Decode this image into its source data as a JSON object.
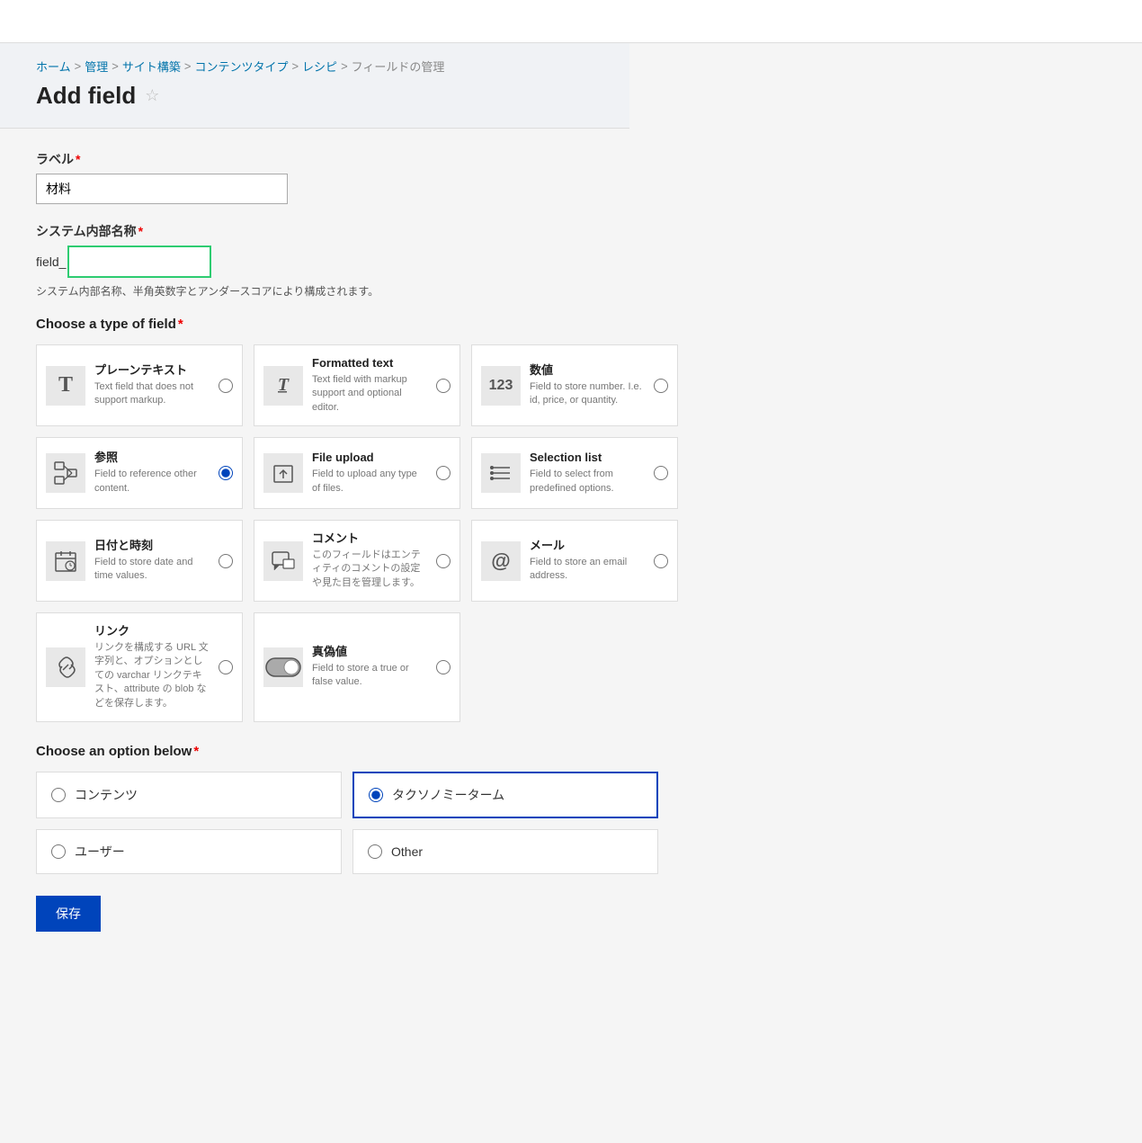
{
  "topBar": {},
  "breadcrumb": {
    "items": [
      "ホーム",
      "管理",
      "サイト構築",
      "コンテンツタイプ",
      "レシピ",
      "フィールドの管理"
    ],
    "separators": [
      ">",
      ">",
      ">",
      ">",
      ">"
    ]
  },
  "pageHeader": {
    "title": "Add field",
    "starLabel": "☆"
  },
  "labelField": {
    "label": "ラベル",
    "required": true,
    "value": "材料",
    "placeholder": ""
  },
  "systemNameField": {
    "label": "システム内部名称",
    "required": true,
    "prefix": "field_",
    "value": "",
    "placeholder": "",
    "helpText": "システム内部名称、半角英数字とアンダースコアにより構成されます。"
  },
  "fieldTypeSection": {
    "title": "Choose a type of field",
    "required": true,
    "types": [
      {
        "id": "plain_text",
        "iconType": "T",
        "name": "プレーンテキスト",
        "desc": "Text field that does not support markup.",
        "selected": false
      },
      {
        "id": "formatted_text",
        "iconType": "formatted",
        "name": "Formatted text",
        "desc": "Text field with markup support and optional editor.",
        "selected": false
      },
      {
        "id": "number",
        "iconType": "123",
        "name": "数値",
        "desc": "Field to store number. I.e. id, price, or quantity.",
        "selected": false
      },
      {
        "id": "reference",
        "iconType": "ref",
        "name": "参照",
        "desc": "Field to reference other content.",
        "selected": true
      },
      {
        "id": "file_upload",
        "iconType": "file",
        "name": "File upload",
        "desc": "Field to upload any type of files.",
        "selected": false
      },
      {
        "id": "selection_list",
        "iconType": "list",
        "name": "Selection list",
        "desc": "Field to select from predefined options.",
        "selected": false
      },
      {
        "id": "date_time",
        "iconType": "date",
        "name": "日付と時刻",
        "desc": "Field to store date and time values.",
        "selected": false
      },
      {
        "id": "comment",
        "iconType": "comment",
        "name": "コメント",
        "desc": "このフィールドはエンティティのコメントの設定や見た目を管理します。",
        "selected": false
      },
      {
        "id": "email",
        "iconType": "email",
        "name": "メール",
        "desc": "Field to store an email address.",
        "selected": false
      },
      {
        "id": "link",
        "iconType": "link",
        "name": "リンク",
        "desc": "リンクを構成する URL 文字列と、オプションとしての varchar リンクテキスト、attribute の blob などを保存します。",
        "selected": false
      },
      {
        "id": "boolean",
        "iconType": "bool",
        "name": "真偽値",
        "desc": "Field to store a true or false value.",
        "selected": false
      }
    ]
  },
  "optionSection": {
    "title": "Choose an option below",
    "required": true,
    "options": [
      {
        "id": "content",
        "label": "コンテンツ",
        "selected": false
      },
      {
        "id": "taxonomy",
        "label": "タクソノミーターム",
        "selected": true
      },
      {
        "id": "user",
        "label": "ユーザー",
        "selected": false
      },
      {
        "id": "other",
        "label": "Other",
        "selected": false
      }
    ]
  },
  "saveButton": {
    "label": "保存"
  }
}
